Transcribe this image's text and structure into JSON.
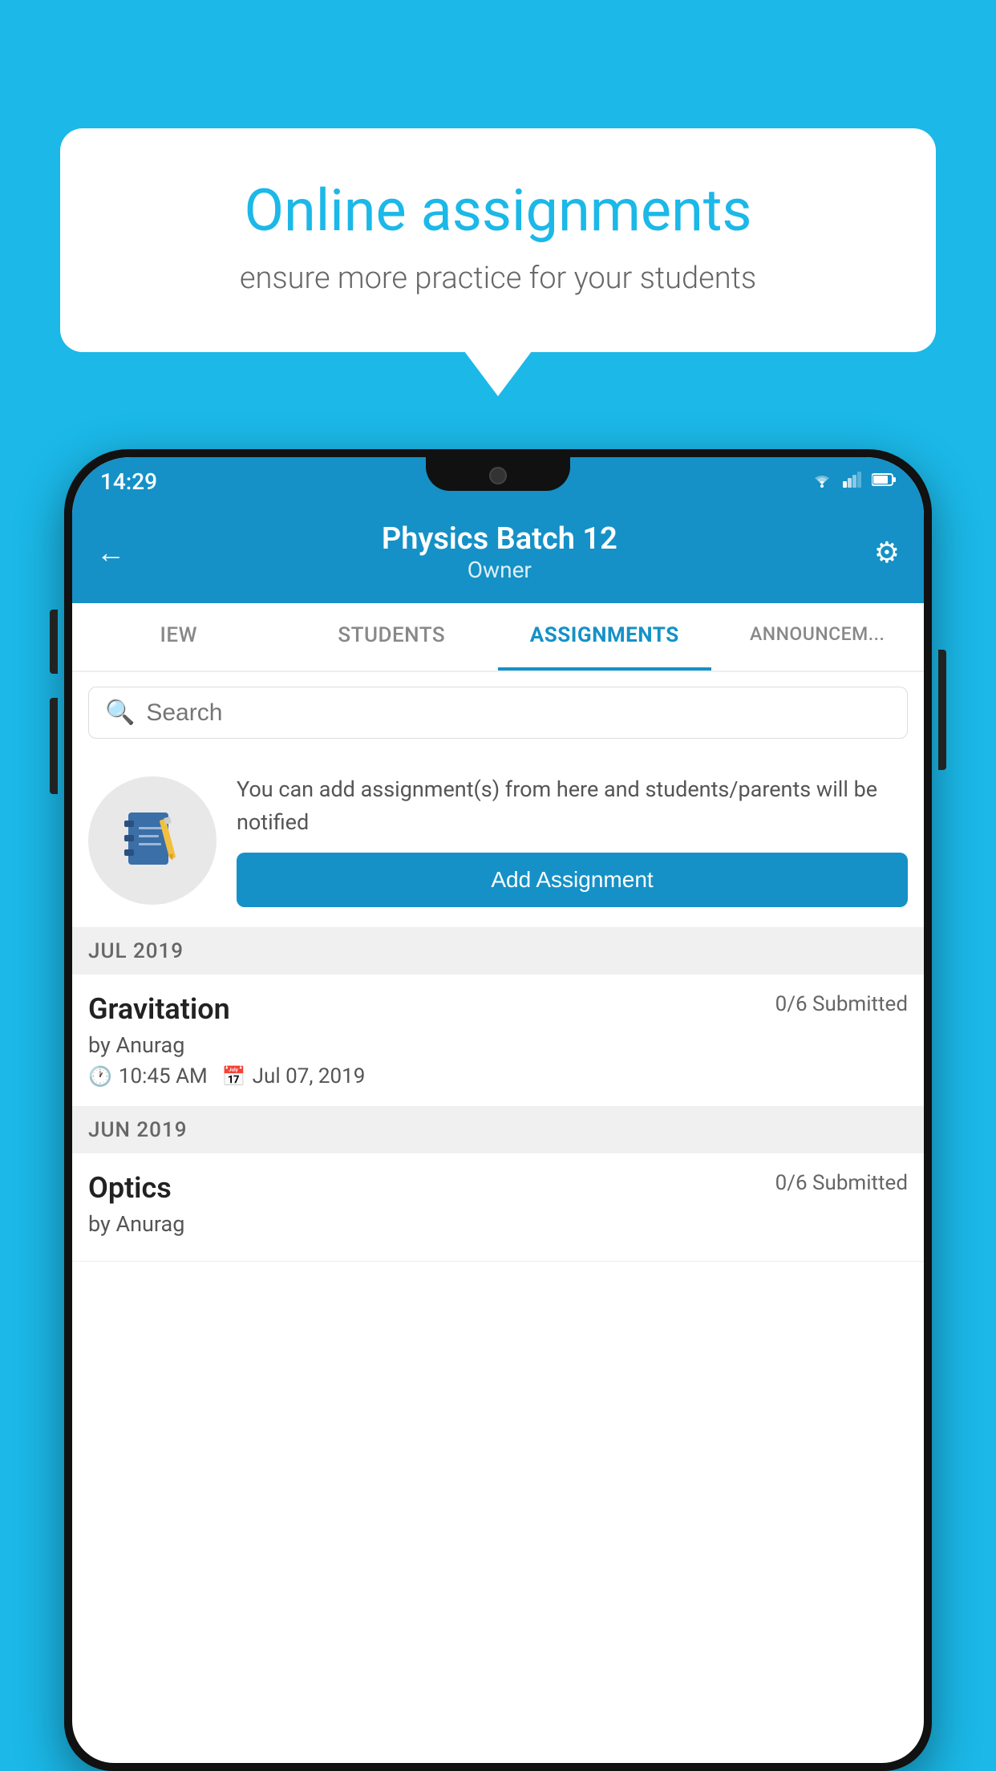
{
  "background_color": "#1BB8E8",
  "speech_bubble": {
    "title": "Online assignments",
    "subtitle": "ensure more practice for your students"
  },
  "status_bar": {
    "time": "14:29",
    "wifi_icon": "wifi",
    "signal_icon": "signal",
    "battery_icon": "battery"
  },
  "app_header": {
    "title": "Physics Batch 12",
    "subtitle": "Owner",
    "back_label": "←",
    "settings_label": "⚙"
  },
  "tabs": [
    {
      "label": "IEW",
      "active": false
    },
    {
      "label": "STUDENTS",
      "active": false
    },
    {
      "label": "ASSIGNMENTS",
      "active": true
    },
    {
      "label": "ANNOUNCEM...",
      "active": false
    }
  ],
  "search": {
    "placeholder": "Search"
  },
  "promo": {
    "text": "You can add assignment(s) from here and students/parents will be notified",
    "button_label": "Add Assignment"
  },
  "sections": [
    {
      "label": "JUL 2019",
      "assignments": [
        {
          "name": "Gravitation",
          "submitted": "0/6 Submitted",
          "by": "by Anurag",
          "time": "10:45 AM",
          "date": "Jul 07, 2019"
        }
      ]
    },
    {
      "label": "JUN 2019",
      "assignments": [
        {
          "name": "Optics",
          "submitted": "0/6 Submitted",
          "by": "by Anurag",
          "time": "",
          "date": ""
        }
      ]
    }
  ]
}
